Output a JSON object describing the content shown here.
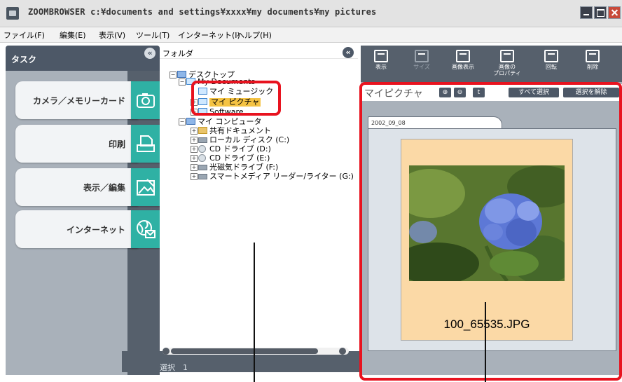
{
  "window": {
    "title": "ZOOMBROWSER c:¥documents and settings¥xxxx¥my documents¥my pictures"
  },
  "menu": [
    "ファイル(F)",
    "編集(E)",
    "表示(V)",
    "ツール(T)",
    "インターネット(I)",
    "ヘルプ(H)"
  ],
  "task_panel": {
    "title": "タスク",
    "items": [
      {
        "label": "カメラ／メモリーカード",
        "icon": "camera-icon"
      },
      {
        "label": "印刷",
        "icon": "print-icon"
      },
      {
        "label": "表示／編集",
        "icon": "edit-icon"
      },
      {
        "label": "インターネット",
        "icon": "internet-icon"
      }
    ],
    "status": "選択　1"
  },
  "folder_panel": {
    "title": "フォルダ",
    "tree": [
      {
        "label": "デスクトップ",
        "icon": "desktop"
      },
      {
        "label": "My Documents",
        "icon": "blue-folder"
      },
      {
        "label": "マイ ミュージック",
        "icon": "blue-folder"
      },
      {
        "label": "マイ ピクチャ",
        "icon": "blue-folder",
        "selected": true
      },
      {
        "label": "Software",
        "icon": "blue-folder"
      },
      {
        "label": "マイ コンピュータ",
        "icon": "pc"
      },
      {
        "label": "共有ドキュメント",
        "icon": "folder"
      },
      {
        "label": "ローカル ディスク (C:)",
        "icon": "drive"
      },
      {
        "label": "CD ドライブ (D:)",
        "icon": "cd"
      },
      {
        "label": "CD ドライブ (E:)",
        "icon": "cd"
      },
      {
        "label": "光磁気ドライブ (F:)",
        "icon": "drive"
      },
      {
        "label": "スマートメディア リーダー/ライター (G:)",
        "icon": "drive"
      }
    ]
  },
  "toolbar": {
    "buttons": [
      {
        "label": "表示",
        "icon": "view-icon",
        "enabled": true
      },
      {
        "label": "サイズ",
        "icon": "size-icon",
        "enabled": false
      },
      {
        "label": "画像表示",
        "icon": "image-view-icon",
        "enabled": true
      },
      {
        "label": "画像の\nプロパティ",
        "icon": "properties-icon",
        "enabled": true
      },
      {
        "label": "回転",
        "icon": "rotate-icon",
        "enabled": true
      },
      {
        "label": "削除",
        "icon": "delete-icon",
        "enabled": true
      }
    ]
  },
  "viewer": {
    "title": "マイピクチャ",
    "select_all": "すべて選択",
    "deselect": "選択を解除",
    "date_tab": "2002_09_08",
    "thumbnail": {
      "filename": "100_65535.JPG"
    }
  },
  "colors": {
    "accent": "#2fb1a4",
    "panel_dark": "#4d5867",
    "highlight": "#e8131f",
    "selection": "#f5c343"
  }
}
